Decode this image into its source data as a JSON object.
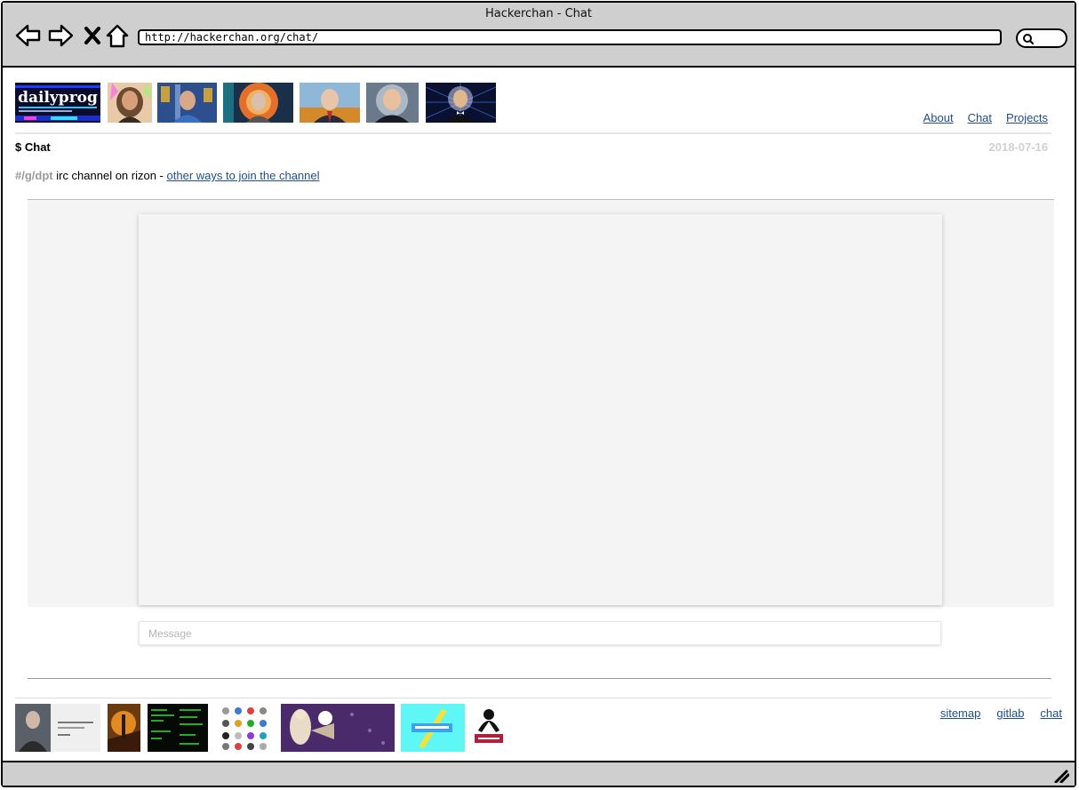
{
  "window": {
    "title": "Hackerchan - Chat"
  },
  "browser": {
    "url": "http://hackerchan.org/chat/"
  },
  "header": {
    "logo_text": "dailyprog",
    "nav": [
      {
        "label": "About"
      },
      {
        "label": "Chat"
      },
      {
        "label": "Projects"
      }
    ]
  },
  "page": {
    "title_prefix": "$",
    "title": "Chat",
    "date": "2018-07-16",
    "channel": "#/g/dpt",
    "description": " irc channel on rizon - ",
    "join_link": "other ways to join the channel"
  },
  "chat": {
    "message_placeholder": "Message",
    "message_value": ""
  },
  "footer": {
    "links": [
      {
        "label": "sitemap"
      },
      {
        "label": "gitlab"
      },
      {
        "label": "chat"
      }
    ]
  },
  "colors": {
    "link": "#1f4e8c",
    "chrome": "#cfcfcf",
    "chat_bg": "#f4f4f4",
    "date": "#d0d0d0"
  }
}
